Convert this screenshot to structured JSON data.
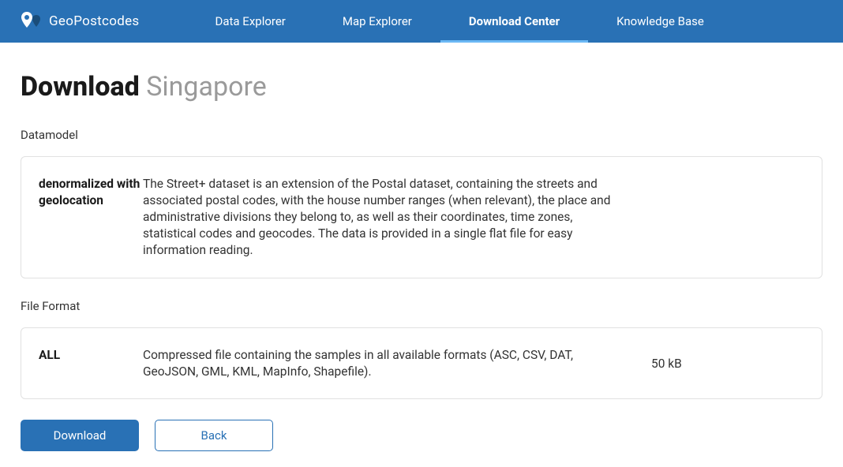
{
  "brand": "GeoPostcodes",
  "nav": {
    "items": [
      {
        "label": "Data Explorer",
        "active": false
      },
      {
        "label": "Map Explorer",
        "active": false
      },
      {
        "label": "Download Center",
        "active": true
      },
      {
        "label": "Knowledge Base",
        "active": false
      }
    ]
  },
  "page": {
    "title_bold": "Download",
    "title_light": "Singapore"
  },
  "datamodel": {
    "section_label": "Datamodel",
    "name": "denormalized with geolocation",
    "description": "The Street+ dataset is an extension of the Postal dataset, containing the streets and associated postal codes, with the house number ranges (when relevant), the place and administrative divisions they belong to, as well as their coordinates, time zones, statistical codes and geocodes. The data is provided in a single flat file for easy information reading."
  },
  "fileformat": {
    "section_label": "File Format",
    "name": "ALL",
    "description": "Compressed file containing the samples in all available formats (ASC, CSV, DAT, GeoJSON, GML, KML, MapInfo, Shapefile).",
    "size": "50 kB"
  },
  "buttons": {
    "download": "Download",
    "back": "Back"
  }
}
